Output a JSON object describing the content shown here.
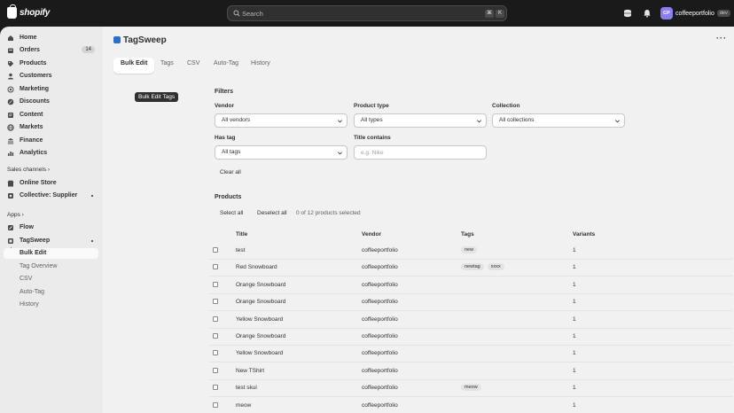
{
  "topbar": {
    "brand": "shopify",
    "search_placeholder": "Search",
    "shortcut_keys": [
      "⌘",
      "K"
    ],
    "store_initials": "CP",
    "store_name": "coffeeportfolio",
    "store_badge": "dev"
  },
  "sidebar": {
    "items": [
      {
        "label": "Home",
        "icon": "home-icon"
      },
      {
        "label": "Orders",
        "icon": "orders-icon",
        "badge": "14"
      },
      {
        "label": "Products",
        "icon": "tag-icon"
      },
      {
        "label": "Customers",
        "icon": "person-icon"
      },
      {
        "label": "Marketing",
        "icon": "target-icon"
      },
      {
        "label": "Discounts",
        "icon": "discount-icon"
      },
      {
        "label": "Content",
        "icon": "content-icon"
      },
      {
        "label": "Markets",
        "icon": "globe-icon"
      },
      {
        "label": "Finance",
        "icon": "bank-icon"
      },
      {
        "label": "Analytics",
        "icon": "chart-icon"
      }
    ],
    "sales_channels_label": "Sales channels",
    "sales_channels": [
      {
        "label": "Online Store",
        "icon": "store-icon"
      },
      {
        "label": "Collective: Supplier",
        "icon": "collective-icon"
      }
    ],
    "apps_label": "Apps",
    "apps": [
      {
        "label": "Flow",
        "icon": "flow-icon"
      },
      {
        "label": "TagSweep",
        "icon": "app-icon"
      }
    ],
    "app_subitems": [
      "Bulk Edit",
      "Tag Overview",
      "CSV",
      "Auto-Tag",
      "History"
    ]
  },
  "main": {
    "app_title": "TagSweep",
    "tabs": [
      "Bulk Edit",
      "Tags",
      "CSV",
      "Auto-Tag",
      "History"
    ],
    "tooltip": "Bulk Edit Tags",
    "filters": {
      "heading": "Filters",
      "vendor_label": "Vendor",
      "vendor_value": "All vendors",
      "product_type_label": "Product type",
      "product_type_value": "All types",
      "collection_label": "Collection",
      "collection_value": "All collections",
      "has_tag_label": "Has tag",
      "has_tag_value": "All tags",
      "title_contains_label": "Title contains",
      "title_contains_placeholder": "e.g. Nike",
      "clear_all": "Clear all"
    },
    "products": {
      "heading": "Products",
      "select_all": "Select all",
      "deselect_all": "Deselect all",
      "selection_status": "0 of 12 products selected",
      "columns": [
        "Title",
        "Vendor",
        "Tags",
        "Variants"
      ],
      "rows": [
        {
          "title": "test",
          "vendor": "coffeeportfolio",
          "tags": [
            "new"
          ],
          "variants": "1"
        },
        {
          "title": "Red Snowboard",
          "vendor": "coffeeportfolio",
          "tags": [
            "newtag",
            "xxxx"
          ],
          "variants": "1"
        },
        {
          "title": "Orange Snowboard",
          "vendor": "coffeeportfolio",
          "tags": [],
          "variants": "1"
        },
        {
          "title": "Orange Snowboard",
          "vendor": "coffeeportfolio",
          "tags": [],
          "variants": "1"
        },
        {
          "title": "Yellow Snowboard",
          "vendor": "coffeeportfolio",
          "tags": [],
          "variants": "1"
        },
        {
          "title": "Orange Snowboard",
          "vendor": "coffeeportfolio",
          "tags": [],
          "variants": "1"
        },
        {
          "title": "Yellow Snowboard",
          "vendor": "coffeeportfolio",
          "tags": [],
          "variants": "1"
        },
        {
          "title": "New TShirt",
          "vendor": "coffeeportfolio",
          "tags": [],
          "variants": "1"
        },
        {
          "title": "test skui",
          "vendor": "coffeeportfolio",
          "tags": [
            "meow"
          ],
          "variants": "1"
        },
        {
          "title": "meow",
          "vendor": "coffeeportfolio",
          "tags": [],
          "variants": "1"
        }
      ]
    }
  }
}
